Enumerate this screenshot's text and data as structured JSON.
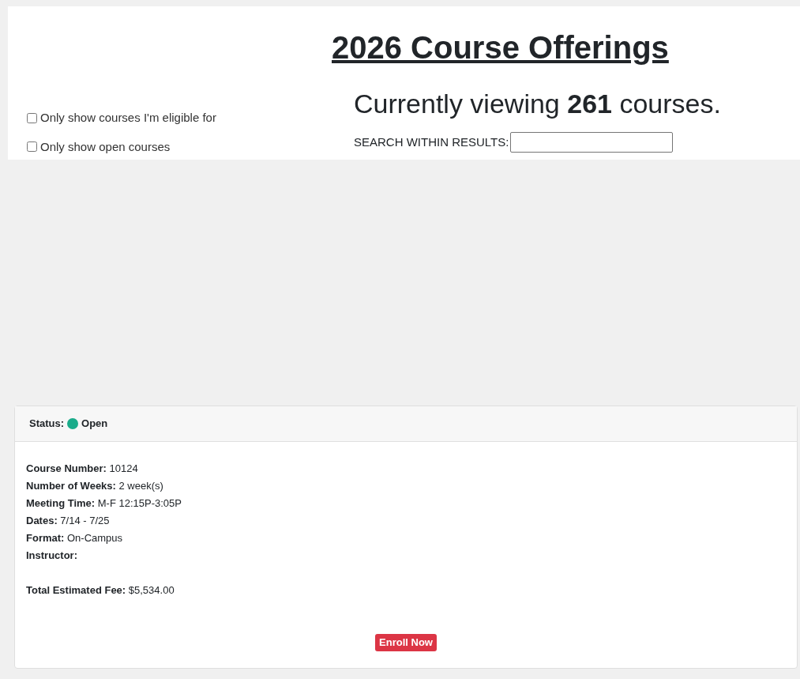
{
  "title": "2026 Course Offerings",
  "filters": [
    {
      "label": "Only show courses I'm eligible for",
      "checked": false
    },
    {
      "label": "Only show open courses",
      "checked": false
    }
  ],
  "summary": "Currently viewing **261** courses.",
  "search": {
    "label": "SEARCH WITHIN RESULTS:"
  },
  "course": {
    "status_label": "Status:",
    "status": {
      "text": "Open",
      "color": "#1aab8a"
    },
    "details": [
      {
        "label": "Course Number:",
        "value": "10124"
      },
      {
        "label": "Number of Weeks:",
        "value": "2 week(s)"
      },
      {
        "label": "Meeting Time:",
        "value": "M-F 12:15P-3:05P"
      },
      {
        "label": "Dates:",
        "value": "7/14 - 7/25"
      },
      {
        "label": "Format:",
        "value": "On-Campus"
      },
      {
        "label": "Instructor:"
      }
    ],
    "fee": {
      "label": "Total Estimated Fee:",
      "value": "$5,534.00"
    },
    "button": "Enroll Now"
  }
}
